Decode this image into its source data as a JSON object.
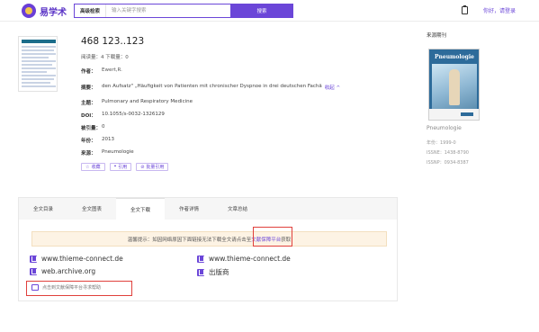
{
  "header": {
    "logo_text": "易学术",
    "search_mode": "高级检索",
    "search_placeholder": "输入关键字搜索",
    "search_button": "搜索",
    "user_link": "你好，请登录"
  },
  "article": {
    "title": "468 123..123",
    "stats": "阅读量：4   下载量：0",
    "fields": [
      {
        "label": "作者：",
        "value": "Ewert,R."
      },
      {
        "label": "摘要：",
        "value": "den Aufsatz\" „Häufigkeit von Patienten mit chronischer Dyspnoe in drei deutschen Fachä",
        "expand": "收起 ^"
      },
      {
        "label": "主题：",
        "value": "Pulmonary and Respiratory Medicine"
      },
      {
        "label": "DOI：",
        "value": "10.1055/s-0032-1326129"
      },
      {
        "label": "被引量：",
        "value": "0"
      },
      {
        "label": "年份：",
        "value": "2013"
      },
      {
        "label": "来源：",
        "value": "Pneumologie"
      }
    ],
    "actions": [
      "收藏",
      "引用",
      "批量引用"
    ]
  },
  "source": {
    "heading": "来源期刊",
    "cover_title": "Pneumologie",
    "name": "Pneumologie",
    "meta": [
      "年份：1999-0",
      "ISSNE：1438-8790",
      "ISSNP：0934-8387"
    ]
  },
  "panel": {
    "tabs": [
      "全文目录",
      "全文图表",
      "全文下载",
      "作者详情",
      "文章总结"
    ],
    "active_tab": 2,
    "notice_prefix": "温馨提示：如因网络原因下面链接无法下载全文请点击至",
    "notice_link": "文献保障平台",
    "notice_suffix": "获取",
    "downloads": [
      "www.thieme-connect.de",
      "www.thieme-connect.de",
      "web.archive.org",
      "出版商"
    ],
    "help_text": "点击到文献保障平台寻求帮助"
  },
  "colors": {
    "accent": "#6b46d8",
    "highlight_box": "#e0403c"
  }
}
